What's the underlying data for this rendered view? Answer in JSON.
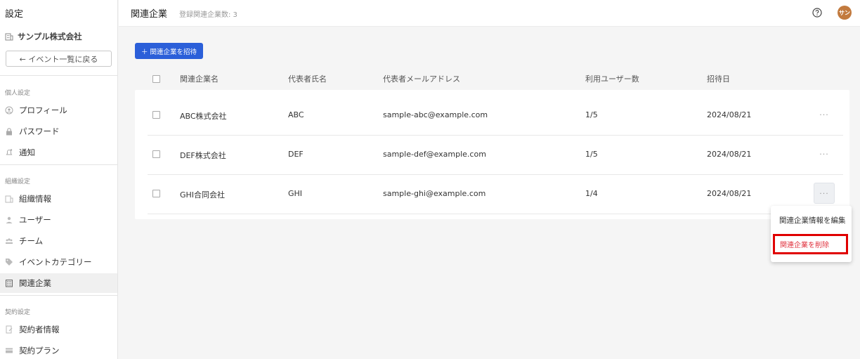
{
  "sidebar": {
    "title": "設定",
    "org_name": "サンプル株式会社",
    "back_label": "← イベント一覧に戻る",
    "sections": [
      {
        "label": "個人設定",
        "items": [
          "プロフィール",
          "パスワード",
          "通知"
        ]
      },
      {
        "label": "組織設定",
        "items": [
          "組織情報",
          "ユーザー",
          "チーム",
          "イベントカテゴリー",
          "関連企業"
        ]
      },
      {
        "label": "契約設定",
        "items": [
          "契約者情報",
          "契約プラン"
        ]
      }
    ],
    "active_item": "関連企業"
  },
  "header": {
    "title": "関連企業",
    "count_text": "登録関連企業数: 3",
    "avatar_text": "サン"
  },
  "main": {
    "invite_label": "＋ 関連企業を招待",
    "columns": [
      "関連企業名",
      "代表者氏名",
      "代表者メールアドレス",
      "利用ユーザー数",
      "招待日"
    ],
    "rows": [
      {
        "name": "ABC株式会社",
        "rep": "ABC",
        "email": "sample-abc@example.com",
        "users": "1/5",
        "date": "2024/08/21"
      },
      {
        "name": "DEF株式会社",
        "rep": "DEF",
        "email": "sample-def@example.com",
        "users": "1/5",
        "date": "2024/08/21"
      },
      {
        "name": "GHI合同会社",
        "rep": "GHI",
        "email": "sample-ghi@example.com",
        "users": "1/4",
        "date": "2024/08/21"
      }
    ],
    "more_label": "···",
    "dropdown": {
      "edit_label": "関連企業情報を編集",
      "delete_label": "関連企業を削除"
    }
  },
  "colors": {
    "primary": "#2b5fd9",
    "danger": "#e0323e",
    "highlight_box": "#e00000",
    "avatar": "#c27a3e"
  }
}
